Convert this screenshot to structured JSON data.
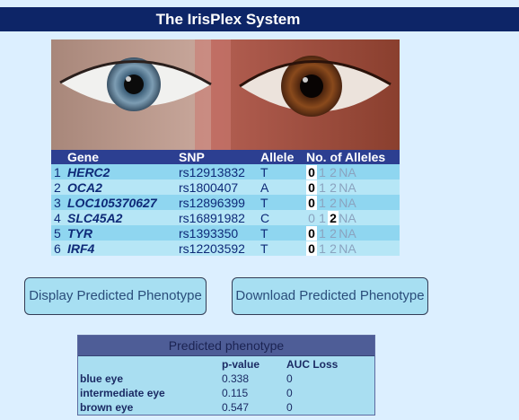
{
  "app": {
    "title": "The IrisPlex System"
  },
  "snp_table": {
    "headers": {
      "gene": "Gene",
      "snp": "SNP",
      "allele": "Allele",
      "count": "No. of Alleles"
    },
    "options": [
      "0",
      "1",
      "2",
      "NA"
    ],
    "rows": [
      {
        "num": "1",
        "gene": "HERC2",
        "snp": "rs12913832",
        "allele": "T",
        "selected": "0"
      },
      {
        "num": "2",
        "gene": "OCA2",
        "snp": "rs1800407",
        "allele": "A",
        "selected": "0"
      },
      {
        "num": "3",
        "gene": "LOC105370627",
        "snp": "rs12896399",
        "allele": "T",
        "selected": "0"
      },
      {
        "num": "4",
        "gene": "SLC45A2",
        "snp": "rs16891982",
        "allele": "C",
        "selected": "2"
      },
      {
        "num": "5",
        "gene": "TYR",
        "snp": "rs1393350",
        "allele": "T",
        "selected": "0"
      },
      {
        "num": "6",
        "gene": "IRF4",
        "snp": "rs12203592",
        "allele": "T",
        "selected": "0"
      }
    ]
  },
  "buttons": {
    "display": "Display Predicted Phenotype",
    "download": "Download Predicted Phenotype"
  },
  "result": {
    "title": "Predicted phenotype",
    "headers": {
      "label": "",
      "pvalue": "p-value",
      "auc": "AUC Loss"
    },
    "rows": [
      {
        "label": "blue eye",
        "pvalue": "0.338",
        "auc": "0"
      },
      {
        "label": "intermediate eye",
        "pvalue": "0.115",
        "auc": "0"
      },
      {
        "label": "brown eye",
        "pvalue": "0.547",
        "auc": "0"
      }
    ]
  },
  "colors": {
    "title_bg": "#0d2567",
    "table_header": "#2c3f91",
    "row_odd": "#8fd6f0",
    "row_even": "#b6e6f6"
  }
}
